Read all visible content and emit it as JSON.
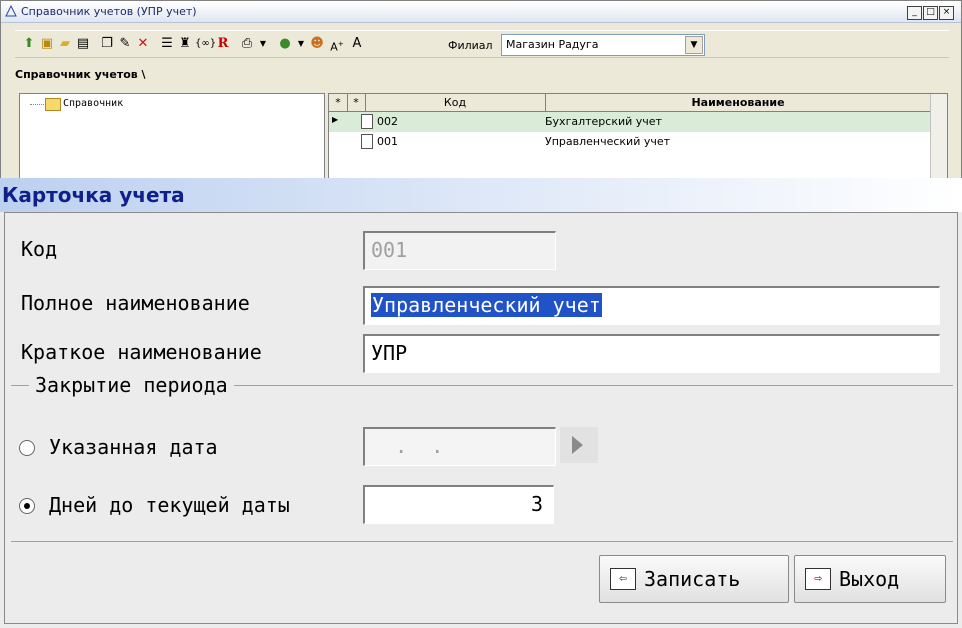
{
  "window": {
    "title": "Справочник учетов (УПР учет)",
    "controls": [
      "_",
      "□",
      "×"
    ]
  },
  "toolbar": {
    "filial_label": "Филиал",
    "filial_value": "Магазин Радуга"
  },
  "breadcrumb": "Справочник учетов \\",
  "tree": {
    "root": "Справочник"
  },
  "grid": {
    "headers": [
      "*",
      "*",
      "Код",
      "Наименование"
    ],
    "rows": [
      {
        "code": "002",
        "name": "Бухгалтерский учет",
        "selected": true
      },
      {
        "code": "001",
        "name": "Управленческий учет",
        "selected": false
      }
    ]
  },
  "card": {
    "title": "Карточка учета",
    "code_label": "Код",
    "code_value": "001",
    "full_name_label": "Полное наименование",
    "full_name_value": "Управленческий учет",
    "short_name_label": "Краткое наименование",
    "short_name_value": "УПР",
    "period_group": "Закрытие периода",
    "option_date_label": "Указанная дата",
    "option_date_value": "  .  .",
    "option_days_label": "Дней до текущей даты",
    "option_days_value": "3",
    "save_label": "Записать",
    "exit_label": "Выход"
  },
  "colors": {
    "accent": "#10208a",
    "selection": "#2052c8",
    "row_highlight": "#d8ecd8"
  }
}
